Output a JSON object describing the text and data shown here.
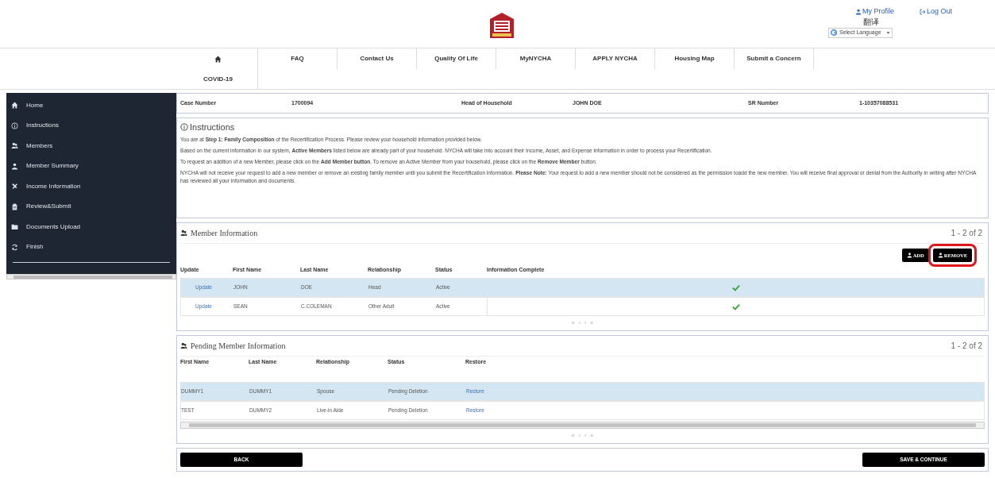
{
  "header": {
    "my_profile": "My Profile",
    "log_out": "Log Out",
    "translate_label": "翻译",
    "language_select": "Select Language"
  },
  "nav": [
    {
      "kind": "home"
    },
    {
      "label": "FAQ",
      "kind": "text"
    },
    {
      "label": "Contact Us",
      "kind": "text"
    },
    {
      "label": "Quality Of Life",
      "kind": "text"
    },
    {
      "label": "MyNYCHA",
      "kind": "text"
    },
    {
      "label": "APPLY NYCHA",
      "kind": "text"
    },
    {
      "label": "Housing Map",
      "kind": "text"
    },
    {
      "label": "Submit a Concern",
      "kind": "text"
    },
    {
      "label": "COVID-19",
      "kind": "text"
    }
  ],
  "sidebar": {
    "items": [
      {
        "label": "Home"
      },
      {
        "label": "Instructions"
      },
      {
        "label": "Members"
      },
      {
        "label": "Member Summary"
      },
      {
        "label": "Income Information"
      },
      {
        "label": "Review&Submit"
      },
      {
        "label": "Documents Upload"
      },
      {
        "label": "Finish"
      }
    ]
  },
  "case_bar": [
    {
      "label": "Case Number",
      "value": "1700094"
    },
    {
      "label": "Head of Household",
      "value": "JOHN DOE"
    },
    {
      "label": "SR Number",
      "value": "1-10357088531"
    }
  ],
  "instructions": {
    "title": "Instructions",
    "paragraphs": [
      "You are at **Step 1: Family Composition** of the Recertification Process. Please review your household information provided below.",
      "Based on the current information in our system, **Active Members** listed below are already part of your household. NYCHA will take into account their Income, Asset, and Expense information in order to process your Recertification.",
      "To request an addition of a new Member, please click on the **Add Member button**. To remove an Active Member from your household, please click on the **Remove Member** button.",
      "NYCHA will not receive your request to add a new member or remove an existing family member until you submit the Recertification information. **Please Note:** Your request to add a new member should not be considered as the permission toadd the new member. You will receive final approval or denial from the Authority in writing after NYCHA has reviewed all your information and documents."
    ]
  },
  "member_information": {
    "title": "Member Information",
    "count": "1 - 2 of 2",
    "buttons": [
      {
        "label": "ADD",
        "highlighted": false
      },
      {
        "label": "REMOVE",
        "highlighted": true
      }
    ],
    "columns": [
      "Update",
      "First Name",
      "Last Name",
      "Relationship",
      "Status",
      "Information Complete"
    ],
    "rows": [
      {
        "update": "Update",
        "first_name": "JOHN",
        "last_name": "DOE",
        "relationship": "Head",
        "status": "Active",
        "complete": true,
        "selected": true
      },
      {
        "update": "Update",
        "first_name": "SEAN",
        "last_name": "C.COLEMAN",
        "relationship": "Other Adult",
        "status": "Active",
        "complete": true,
        "selected": false
      }
    ],
    "pager": [
      "«",
      "‹",
      "›",
      "»"
    ]
  },
  "pending_member_information": {
    "title": "Pending Member Information",
    "count": "1 - 2 of 2",
    "columns": [
      "First Name",
      "Last Name",
      "Relationship",
      "Status",
      "Restore"
    ],
    "rows": [
      {
        "first_name": "DUMMY1",
        "last_name": "DUMMY1",
        "relationship": "Spouse",
        "status": "Pending Deletion",
        "restore": "Restore",
        "selected": true
      },
      {
        "first_name": "TEST",
        "last_name": "DUMMY2",
        "relationship": "Live-in Aide",
        "status": "Pending Deletion",
        "restore": "Restore",
        "selected": false
      }
    ],
    "pager": [
      "«",
      "‹",
      "›",
      "»"
    ]
  },
  "footer": {
    "back": "BACK",
    "save": "SAVE & CONTINUE"
  }
}
